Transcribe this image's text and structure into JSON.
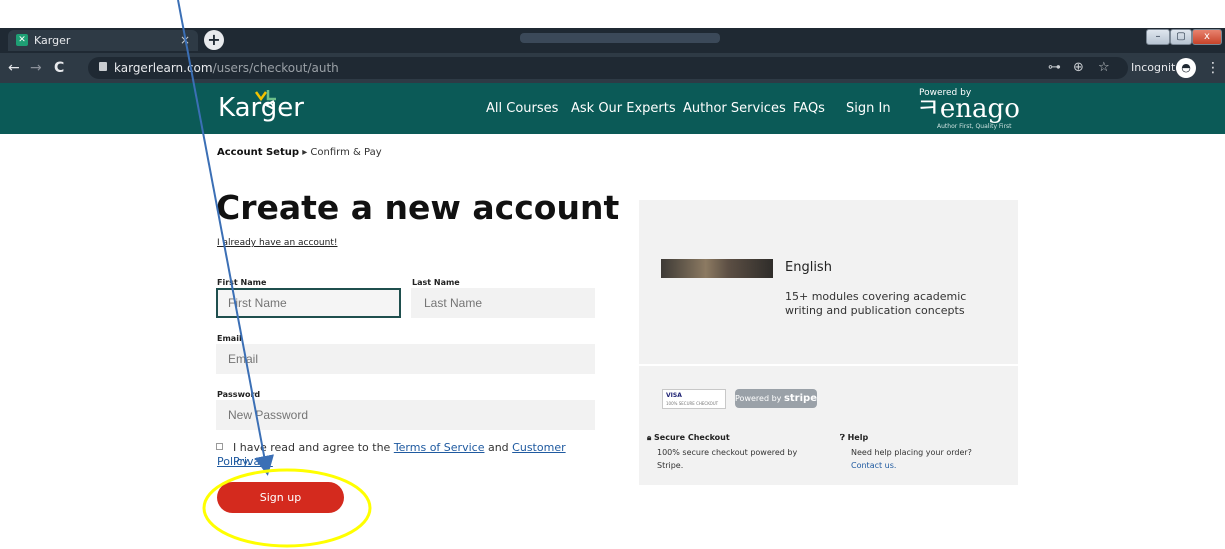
{
  "browser": {
    "tab_title": "Karger",
    "tab_close": "×",
    "new_tab": "+",
    "url_host": "kargerlearn.com",
    "url_path": "/users/checkout/auth",
    "incognito_label": "Incognito",
    "nav_back": "←",
    "nav_forward": "→",
    "nav_reload": "C",
    "key_icon": "⊶",
    "zoom_icon": "⊕",
    "star_icon": "☆",
    "menu_icon": "⋮",
    "win_min": "–",
    "win_max": "▢",
    "win_close": "x"
  },
  "header": {
    "logo": "Karger",
    "nav": [
      "All Courses",
      "Ask Our Experts",
      "Author Services",
      "FAQs",
      "Sign In"
    ],
    "powered_by": "Powered by",
    "enago": "enago",
    "enago_tagline": "Author First, Quality First",
    "brand_color": "#0b5a57"
  },
  "breadcrumb": {
    "current": "Account Setup",
    "separator": "▸",
    "next": "Confirm & Pay"
  },
  "form": {
    "title": "Create a new account",
    "login_link": "I already have an account!",
    "first_name_label": "First Name",
    "first_name_placeholder": "First Name",
    "last_name_label": "Last Name",
    "last_name_placeholder": "Last Name",
    "email_label": "Email",
    "email_placeholder": "Email",
    "password_label": "Password",
    "password_placeholder": "New Password",
    "terms_prefix": "I have read and agree to the ",
    "terms_link": "Terms of Service",
    "terms_and": " and ",
    "privacy_link_a": "Customer Privacy",
    "privacy_link_b": "Policy.",
    "submit": "Sign up",
    "submit_color": "#d42a1e"
  },
  "summary": {
    "course_language": "English",
    "course_description": "15+ modules covering academic writing and publication concepts",
    "card_badge": "VISA",
    "card_badge_sub": "100% SECURE CHECKOUT",
    "stripe_prefix": "Powered by ",
    "stripe_brand": "stripe",
    "secure_title": "Secure Checkout",
    "secure_text_1": "100% secure checkout powered by",
    "secure_text_2": "Stripe.",
    "help_title": "Help",
    "help_text": "Need help placing your order?",
    "help_link": "Contact us."
  },
  "annotation": {
    "arrow_color": "#3b6fb5",
    "highlight_color": "#ffff00"
  }
}
